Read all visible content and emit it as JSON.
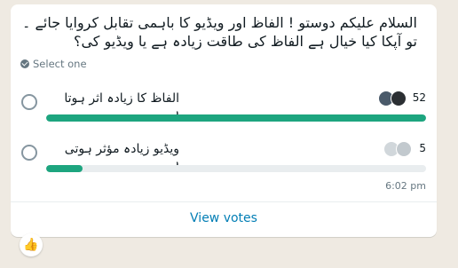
{
  "poll": {
    "question": "السلام علیکم دوستو ! الفاظ اور ویڈیو کا باہمی تقابل کروایا جائے ۔ تو آپکا کیا خیال ہے الفاظ کی طاقت زیادہ ہے یا ویڈیو کی؟",
    "select_hint": "Select one",
    "options": [
      {
        "label": "الفاظ کا زیادہ اثر ہوتا ہے",
        "votes": "52",
        "fill_fraction": 1.0
      },
      {
        "label": "ویڈیو زیادہ مؤثر ہوتی ہے",
        "votes": "5",
        "fill_fraction": 0.096
      }
    ],
    "time": "6:02 pm",
    "view_votes": "View votes"
  },
  "reaction": {
    "emoji": "👍"
  },
  "colors": {
    "accent": "#1da57f",
    "link": "#027eb5"
  }
}
